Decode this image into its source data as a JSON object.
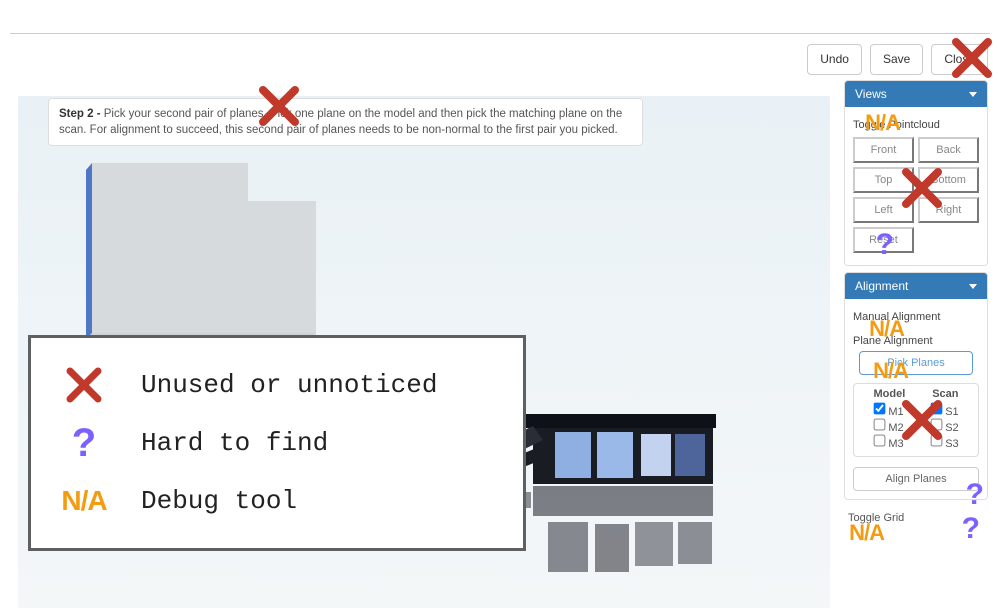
{
  "topbar": {
    "undo": "Undo",
    "save": "Save",
    "close": "Close"
  },
  "instruction": {
    "step_label": "Step 2 -",
    "text": "Pick your second pair of planes. Pick one plane on the model and then pick the matching plane on the scan. For alignment to succeed, this second pair of planes needs to be non-normal to the first pair you picked."
  },
  "sidebar": {
    "views": {
      "title": "Views",
      "toggle_pointcloud": "Toggle Pointcloud",
      "front": "Front",
      "back": "Back",
      "top": "Top",
      "bottom": "Bottom",
      "left": "Left",
      "right": "Right",
      "reset": "Reset"
    },
    "alignment": {
      "title": "Alignment",
      "manual_label": "Manual Alignment",
      "plane_label": "Plane Alignment",
      "pick_planes": "Pick Planes",
      "model": "Model",
      "scan": "Scan",
      "m1": "M1",
      "s1": "S1",
      "m2": "M2",
      "s2": "S2",
      "m3": "M3",
      "s3": "S3",
      "align_planes": "Align Planes",
      "toggle_grid": "Toggle Grid"
    }
  },
  "legend": {
    "unused": "Unused or unnoticed",
    "hard": "Hard to find",
    "debug": "Debug tool",
    "na": "N/A",
    "q": "?"
  }
}
